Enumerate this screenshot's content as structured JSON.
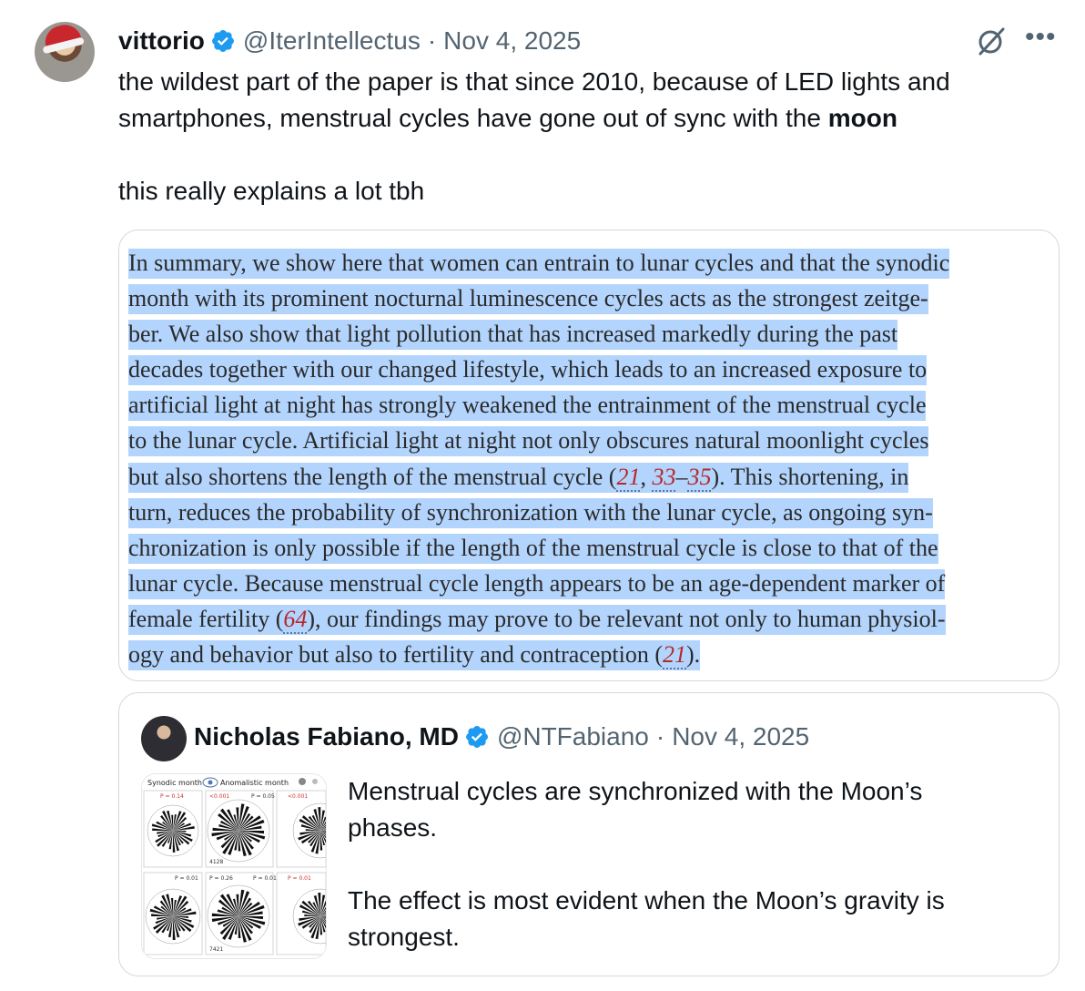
{
  "tweet": {
    "author_name": "vittorio",
    "author_handle": "@IterIntellectus",
    "separator": "·",
    "date": "Nov 4, 2025",
    "text_line1": "the wildest part of the paper is that since 2010, because of LED lights and",
    "text_line2_pre": "smartphones, menstrual cycles have gone out of sync with the ",
    "text_line2_bold": "moon",
    "text_line3": "this really explains a lot tbh"
  },
  "image": {
    "lines": [
      "In summary, we show here that women can entrain to lunar cycles and that the synodic",
      "month with its prominent nocturnal luminescence cycles acts as the strongest zeitge-",
      "ber. We also show that light pollution that has increased markedly during the past",
      "decades together with our changed lifestyle, which leads to an increased exposure to",
      "artificial light at night has strongly weakened the entrainment of the menstrual cycle",
      "to the lunar cycle. Artificial light at night not only obscures natural moonlight cycles"
    ],
    "line7_a": "but also shortens the length of the menstrual cycle (",
    "ref_21": "21",
    "line7_b": ", ",
    "ref_33": "33",
    "line7_c": "–",
    "ref_35": "35",
    "line7_d": "). This shortening, in",
    "line8": "turn, reduces the probability of synchronization with the lunar cycle, as ongoing syn-",
    "line9": "chronization is only possible if the length of the menstrual cycle is close to that of the",
    "line10": "lunar cycle. Because menstrual cycle length appears to be an age-dependent marker of",
    "line11_a": "female fertility (",
    "ref_64": "64",
    "line11_b": "), our findings may prove to be relevant not only to human physiol-",
    "line12_a": "ogy and behavior but also to fertility and contraception (",
    "ref_21b": "21",
    "line12_b": ")."
  },
  "quote": {
    "author_name": "Nicholas Fabiano, MD",
    "author_handle": "@NTFabiano",
    "separator": "·",
    "date": "Nov 4, 2025",
    "text_line1": "Menstrual cycles are synchronized with the Moon’s",
    "text_line2": "phases.",
    "text_line3": "The effect is most evident when the Moon’s gravity is",
    "text_line4": "strongest."
  },
  "thumbnail": {
    "label_synodic": "Synodic month",
    "label_anomalistic": "Anomalistic month",
    "p_values": [
      "P = 0.14",
      "<0.001",
      "P = 0.05",
      "<0.001",
      "P = 0.01",
      "P = 0.26",
      "P = 0.01",
      "P = 0.01"
    ],
    "n_values": [
      "4128",
      "7421"
    ]
  },
  "colors": {
    "verified": "#1d9bf0",
    "highlight": "#b3d4fc",
    "ref_red": "#b22a2a",
    "muted": "#536471",
    "border": "#cfd9de"
  },
  "icons": [
    "verified-badge-icon",
    "grok-icon",
    "more-icon"
  ]
}
